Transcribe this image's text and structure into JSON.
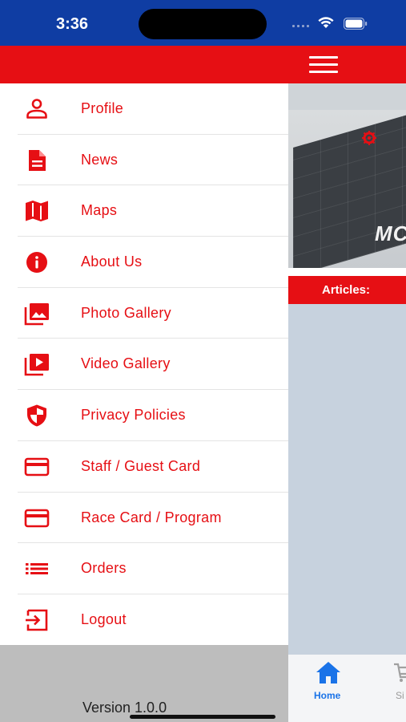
{
  "status_bar": {
    "time": "3:36"
  },
  "header": {
    "menu_icon": "hamburger-icon"
  },
  "drawer": {
    "items": [
      {
        "label": "Profile",
        "icon": "person-icon"
      },
      {
        "label": "News",
        "icon": "document-icon"
      },
      {
        "label": "Maps",
        "icon": "map-icon"
      },
      {
        "label": "About Us",
        "icon": "info-icon"
      },
      {
        "label": "Photo Gallery",
        "icon": "photo-gallery-icon"
      },
      {
        "label": "Video Gallery",
        "icon": "video-gallery-icon"
      },
      {
        "label": "Privacy Policies",
        "icon": "shield-icon"
      },
      {
        "label": "Staff / Guest Card",
        "icon": "card-icon"
      },
      {
        "label": "Race Card / Program",
        "icon": "card-icon"
      },
      {
        "label": "Orders",
        "icon": "list-icon"
      },
      {
        "label": "Logout",
        "icon": "logout-icon"
      }
    ],
    "version": "Version 1.0.0"
  },
  "background": {
    "hero_text": "MC",
    "articles_label": "Articles:"
  },
  "tabs": [
    {
      "label": "Home",
      "icon": "home-icon"
    },
    {
      "label": "Si",
      "icon": "cart-icon"
    }
  ],
  "colors": {
    "accent_red": "#e60f14",
    "status_blue": "#0f3da3",
    "tab_active_blue": "#1a73e8",
    "footer_grey": "#bdbdbd",
    "content_blue_grey": "#c7d2de"
  }
}
